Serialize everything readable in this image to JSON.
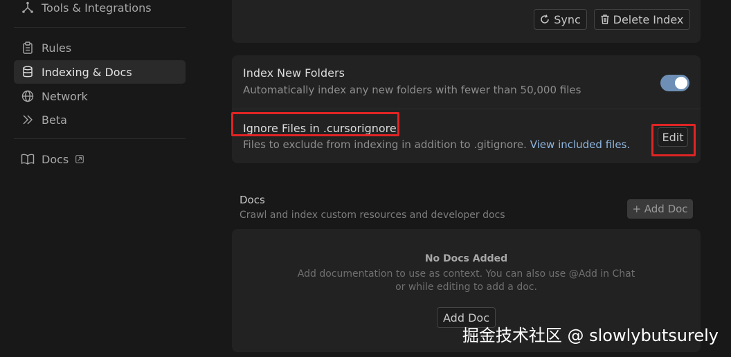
{
  "sidebar": {
    "top_item": {
      "label": "Tools & Integrations",
      "icon": "tools-icon"
    },
    "items": [
      {
        "label": "Rules",
        "icon": "clipboard-icon",
        "active": false
      },
      {
        "label": "Indexing & Docs",
        "icon": "database-icon",
        "active": true
      },
      {
        "label": "Network",
        "icon": "globe-icon",
        "active": false
      },
      {
        "label": "Beta",
        "icon": "chevrons-right-icon",
        "active": false
      }
    ],
    "docs_item": {
      "label": "Docs",
      "icon": "book-icon",
      "external_icon": "external-link-icon"
    }
  },
  "index_card": {
    "sync_label": "Sync",
    "delete_label": "Delete Index"
  },
  "settings_card": {
    "new_folders": {
      "title": "Index New Folders",
      "desc": "Automatically index any new folders with fewer than 50,000 files",
      "enabled": true
    },
    "ignore_files": {
      "title": "Ignore Files in .cursorignore",
      "desc": "Files to exclude from indexing in addition to .gitignore.",
      "link": "View included files.",
      "edit_label": "Edit"
    }
  },
  "docs_section": {
    "title": "Docs",
    "desc": "Crawl and index custom resources and developer docs",
    "add_doc_header_label": "+ Add Doc",
    "empty_title": "No Docs Added",
    "empty_desc_line1": "Add documentation to use as context. You can also use @Add in Chat",
    "empty_desc_line2": "or while editing to add a doc.",
    "add_doc_label": "Add Doc"
  },
  "watermark": "掘金技术社区 @ slowlybutsurely",
  "colors": {
    "background": "#181818",
    "card": "#222222",
    "toggle_on": "#6d8fb5",
    "highlight": "#e02424",
    "link": "#8fb6e0"
  }
}
